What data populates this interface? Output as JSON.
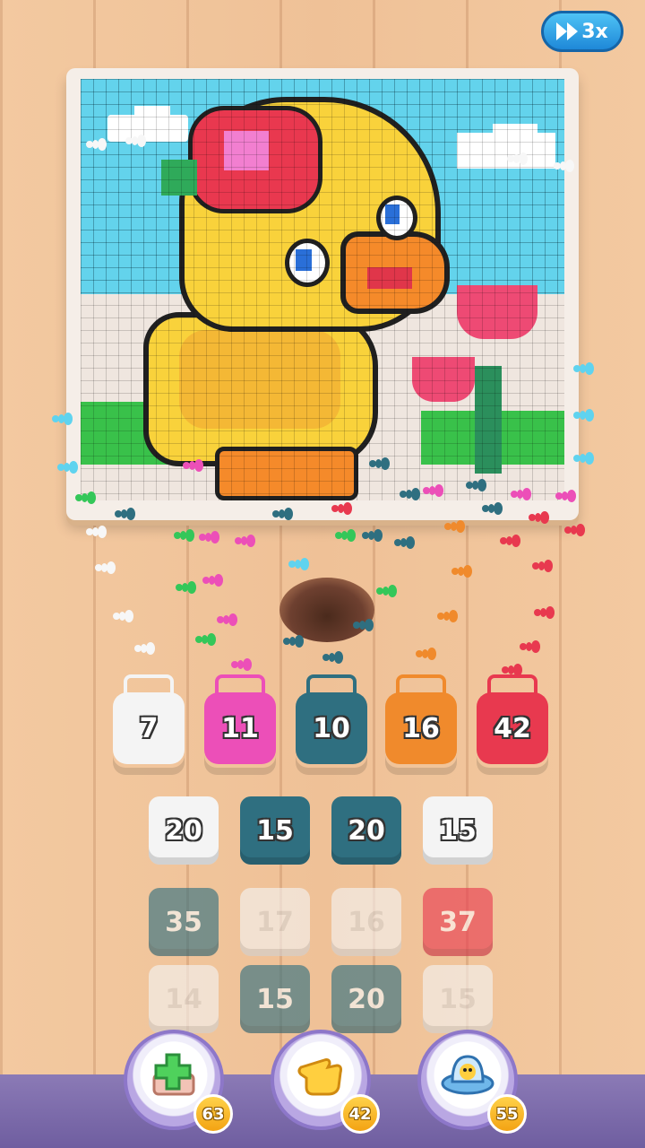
{
  "speed_button": {
    "label": "3x"
  },
  "colors": {
    "white": "#f4f4f4",
    "pink": "#ec4fb8",
    "teal": "#2f6f80",
    "orange": "#f08a2c",
    "red": "#e8394f",
    "sky": "#63d3ec",
    "duck": "#f9d23b",
    "duck_shade": "#f0a331"
  },
  "jars": [
    {
      "name": "jar-white",
      "color": "#f4f4f4",
      "value": "7"
    },
    {
      "name": "jar-pink",
      "color": "#ec4fb8",
      "value": "11"
    },
    {
      "name": "jar-teal",
      "color": "#2f6f80",
      "value": "10"
    },
    {
      "name": "jar-orange",
      "color": "#f08a2c",
      "value": "16"
    },
    {
      "name": "jar-red",
      "color": "#e8394f",
      "value": "42"
    }
  ],
  "tiles": [
    [
      {
        "color": "#f4f4f4",
        "value": "20",
        "active": true
      },
      {
        "color": "#2f6f80",
        "value": "15",
        "active": true
      },
      {
        "color": "#2f6f80",
        "value": "20",
        "active": true
      },
      {
        "color": "#f4f4f4",
        "value": "15",
        "active": true
      }
    ],
    [
      {
        "color": "#2f6f80",
        "value": "35",
        "active": false
      },
      {
        "color": "#f4f4f4",
        "value": "17",
        "active": false
      },
      {
        "color": "#f4f4f4",
        "value": "16",
        "active": false
      },
      {
        "color": "#e8394f",
        "value": "37",
        "active": false
      }
    ],
    [
      {
        "color": "#f4f4f4",
        "value": "14",
        "active": false
      },
      {
        "color": "#2f6f80",
        "value": "15",
        "active": false
      },
      {
        "color": "#2f6f80",
        "value": "20",
        "active": false
      },
      {
        "color": "#f4f4f4",
        "value": "15",
        "active": false
      }
    ]
  ],
  "boosters": [
    {
      "name": "add-slot-booster",
      "icon": "plus-icon",
      "count": "63"
    },
    {
      "name": "hand-booster",
      "icon": "hand-icon",
      "count": "42"
    },
    {
      "name": "ufo-booster",
      "icon": "ufo-icon",
      "count": "55"
    }
  ]
}
